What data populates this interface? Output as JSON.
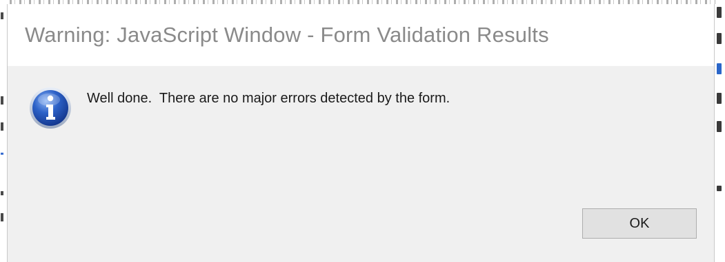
{
  "dialog": {
    "title": "Warning: JavaScript Window - Form Validation Results",
    "icon": "info-icon",
    "message": "Well done.  There are no major errors detected by the form.",
    "ok_label": "OK"
  },
  "colors": {
    "title_text": "#8a8a8a",
    "dialog_body": "#f0f0f0",
    "title_bar": "#ffffff",
    "button_face": "#e1e1e1",
    "button_border": "#adadad",
    "icon_blue": "#1f4fb0"
  }
}
